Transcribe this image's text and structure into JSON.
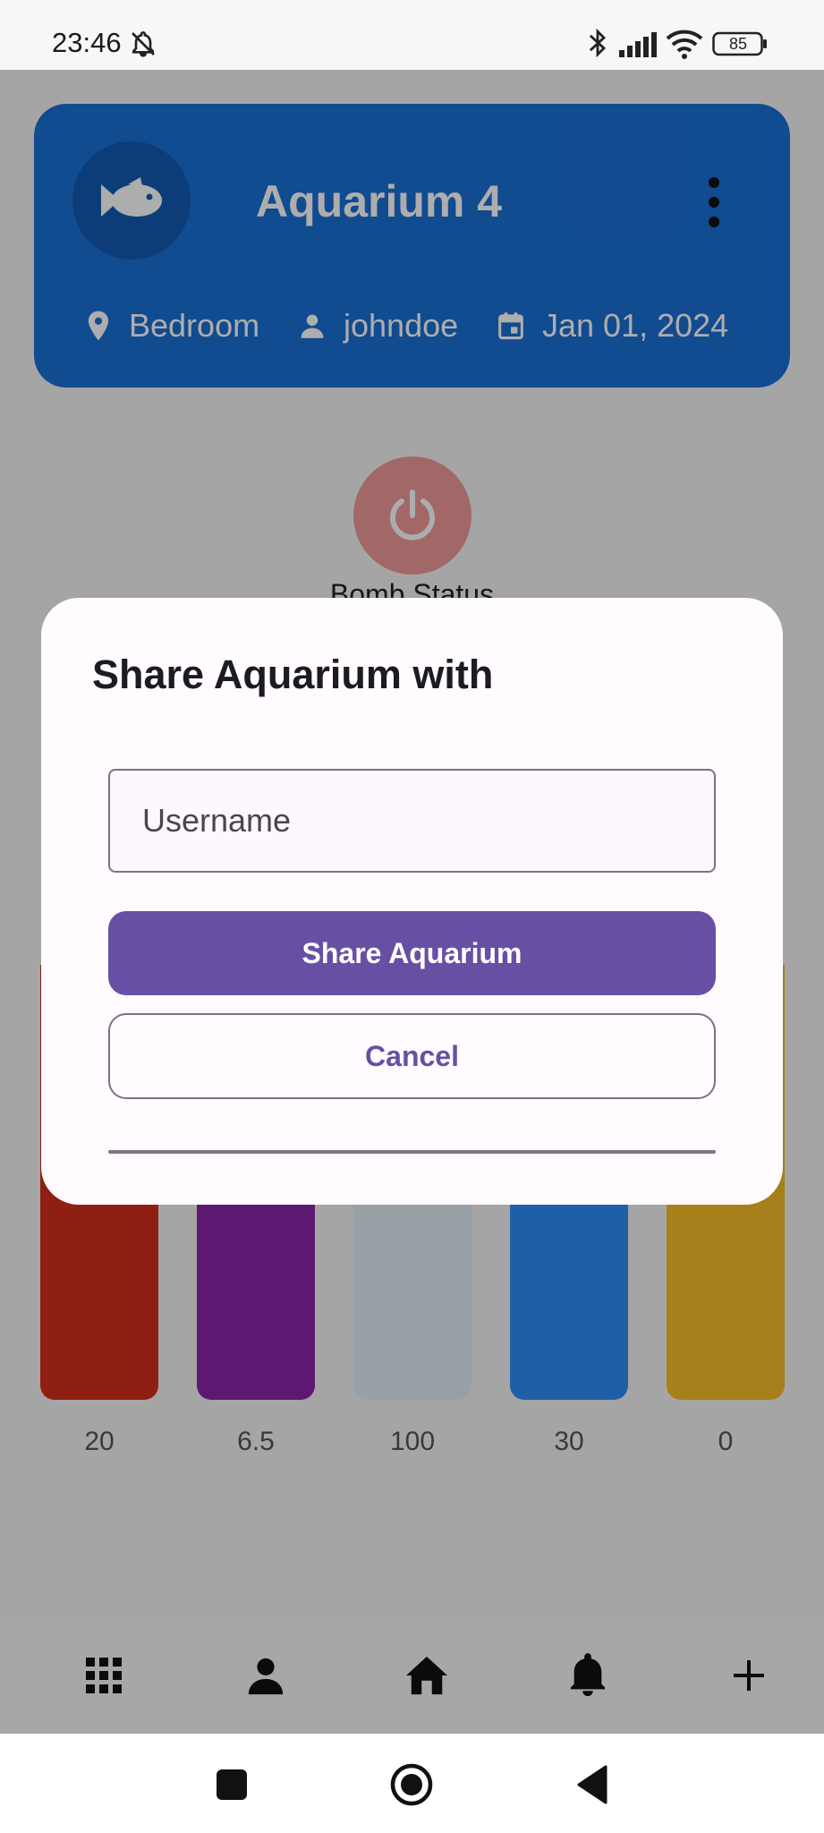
{
  "status_bar": {
    "time": "23:46",
    "battery": "85",
    "icons": [
      "bell-off-icon",
      "bluetooth-icon",
      "cellular-signal-icon",
      "wifi-icon",
      "battery-icon"
    ]
  },
  "aquarium": {
    "name": "Aquarium 4",
    "location": "Bedroom",
    "owner": "johndoe",
    "created": "Jan 01, 2024",
    "icon": "fish-icon",
    "menu_icon": "more-vertical-icon"
  },
  "pump": {
    "label": "Bomb Status",
    "icon": "power-icon",
    "color": "#ef9a9a"
  },
  "parameters": [
    {
      "value": "20",
      "color": "#d42f1c"
    },
    {
      "value": "6.5",
      "color": "#8a25a8"
    },
    {
      "value": "100",
      "color": "#dfeef3"
    },
    {
      "value": "30",
      "color": "#2f8df6"
    },
    {
      "value": "0",
      "color": "#f7bd2a"
    }
  ],
  "bottom_nav": {
    "items": [
      "apps-grid-icon",
      "person-icon",
      "home-icon",
      "notifications-icon",
      "add-icon"
    ]
  },
  "dialog": {
    "title": "Share Aquarium with",
    "input_placeholder": "Username",
    "input_value": "",
    "share_label": "Share Aquarium",
    "cancel_label": "Cancel"
  },
  "system_nav": {
    "items": [
      "recents-square-icon",
      "home-circle-icon",
      "back-triangle-icon"
    ]
  },
  "colors": {
    "header": "#1a6fd4",
    "primary": "#6750a4",
    "scrim": "rgba(0,0,0,0.32)"
  }
}
